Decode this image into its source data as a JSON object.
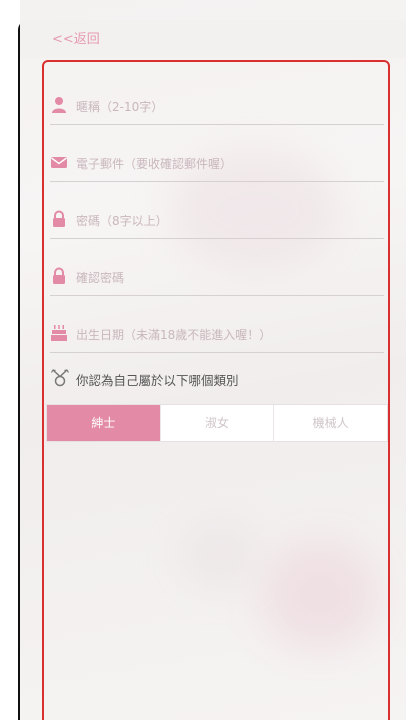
{
  "topbar": {
    "back_label": "<<返回"
  },
  "form": {
    "fields": [
      {
        "icon": "user-icon",
        "placeholder": "暱稱（2-10字）"
      },
      {
        "icon": "mail-icon",
        "placeholder": "電子郵件（要收確認郵件喔）"
      },
      {
        "icon": "lock-icon",
        "placeholder": "密碼（8字以上）"
      },
      {
        "icon": "lock-icon",
        "placeholder": "確認密碼"
      },
      {
        "icon": "cake-icon",
        "placeholder": "出生日期（未滿18歲不能進入喔！）"
      }
    ],
    "question": {
      "icon": "gender-icon",
      "text": "你認為自己屬於以下哪個類別"
    },
    "gender_options": [
      "紳士",
      "淑女",
      "機械人"
    ],
    "selected_option": "紳士"
  },
  "colors": {
    "accent": "#e38aa6",
    "form_border": "#d9302f",
    "phone_frame": "#101010"
  }
}
